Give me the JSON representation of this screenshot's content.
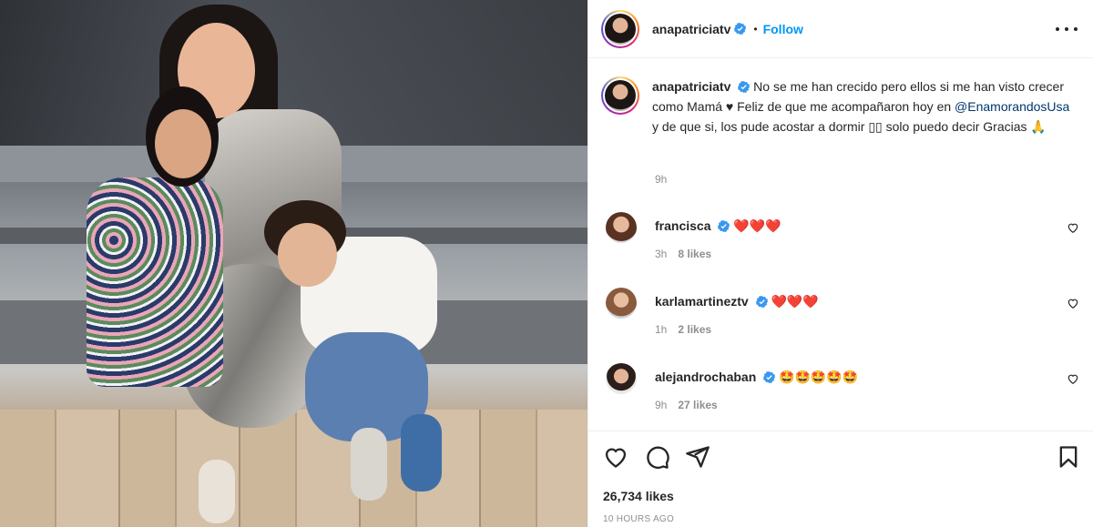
{
  "post": {
    "username": "anapatriciatv",
    "follow_label": "Follow",
    "separator": "•",
    "caption": {
      "username": "anapatriciatv",
      "text_1": "No se me han crecido pero ellos si me han visto crecer como Mamá ♥ Feliz de que me acompañaron hoy en",
      "mention": "@EnamorandosUsa",
      "text_2": "y de que si, los pude acostar a dormir ▯▯ solo puedo decir Gracias 🙏",
      "time": "9h"
    },
    "comments": [
      {
        "username": "francisca",
        "text": "❤️❤️❤️",
        "time": "3h",
        "likes": "8 likes"
      },
      {
        "username": "karlamartineztv",
        "text": "❤️❤️❤️",
        "time": "1h",
        "likes": "2 likes"
      },
      {
        "username": "alejandrochaban",
        "text": "🤩🤩🤩🤩🤩",
        "time": "9h",
        "likes": "27 likes"
      }
    ],
    "likes": "26,734 likes",
    "posted_ago": "10 HOURS AGO"
  },
  "icons": {
    "more": "more-options-icon",
    "verified": "verified-badge-icon",
    "like": "heart-icon",
    "comment": "comment-icon",
    "share": "share-icon",
    "save": "bookmark-icon"
  },
  "colors": {
    "accent": "#0095f6",
    "verified": "#3897f0",
    "text": "#262626",
    "muted": "#8e8e8e",
    "mention": "#00376b"
  }
}
